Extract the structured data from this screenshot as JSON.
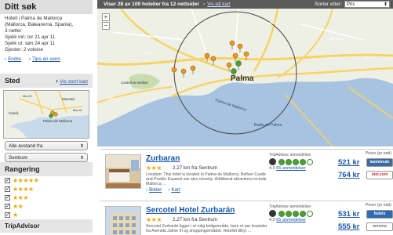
{
  "sidebar": {
    "search": {
      "title": "Ditt søk",
      "lines": [
        "Hotell i Palma de Mallorca",
        "(Mallorca, Balearerna, Spania),",
        "3 netter",
        "Sjekk inn: tor 21 apr 11",
        "Sjekk ut: søn 24 apr 11",
        "Gjester: 2 voksne"
      ],
      "edit_label": "Endre",
      "tips_label": "Tips en venn"
    },
    "place": {
      "title": "Sted",
      "big_map_label": "Vis stort kart",
      "mini_map_labels": [
        "Palma de Mallorca",
        "Marratxí",
        "Ma-13",
        "Ma-19",
        "Calvià"
      ],
      "distance_select": "Alle avstand fra",
      "center_select": "Sentrum"
    },
    "rating": {
      "title": "Rangering",
      "rows": [
        {
          "stars": "★★★★★",
          "checked": "✓"
        },
        {
          "stars": "★★★★",
          "checked": "✓"
        },
        {
          "stars": "★★★",
          "checked": "✓"
        },
        {
          "stars": "★★",
          "checked": "✓"
        },
        {
          "stars": "★",
          "checked": "✓"
        }
      ]
    },
    "tripadvisor": {
      "title": "TripAdvisor"
    }
  },
  "topbar": {
    "count_text": "Viser 28 av 109 hoteller fra 12 nettsider",
    "map_link": "Vis på kart",
    "sort_label": "Sorter etter:",
    "sort_value": "Pris"
  },
  "map": {
    "labels": [
      "Palma",
      "Palma de Mallorca",
      "Ma-20",
      "Ma-19",
      "Ma-13",
      "Ma-1",
      "Castell de Bellver",
      "Ma-1044",
      "Badia de Palma"
    ],
    "colors": {
      "water": "#a8c3e0",
      "land": "#eef0e6",
      "road": "#f6d364",
      "marker": "#f39a1e",
      "selected": "#3fa532"
    }
  },
  "results": [
    {
      "name": "Zurbaran",
      "stars": "★★★",
      "distance": "2,27 km fra Sentrum",
      "description": "Location: This hotel is located in Palma de Mallorca, Bellver Castle and Pueblo Espanol are also closeby. Additional attractions include Mallorca ...",
      "photo_link": "Bilder",
      "map_link": "Kart",
      "ta_label": "TripAdvisor anmeldelser",
      "ta_score": "4.0",
      "ta_reviews": "65 anmeldelser",
      "prices_label": "Priser (pr natt)",
      "prices": [
        {
          "price": "521 kr",
          "site": "lastminute",
          "color": "#3b6aa0"
        },
        {
          "price": "764 kr",
          "site": "otel.com",
          "color": "#c9302c"
        }
      ]
    },
    {
      "name": "Sercotel Hotel Zurbarán",
      "stars": "★★★",
      "distance": "2,27 km fra Sentrum",
      "description": "Sercotel Zurbarán ligger i et rolig boligområde, bare et par kvartaler fra Avenida Jaime III og shoppingområdet. Hotellet tilbyr ...",
      "photo_link": "Bilder",
      "map_link": "Kart",
      "ta_label": "TripAdvisor anmeldelser",
      "ta_score": "4.0",
      "ta_reviews": "65 anmeldelser",
      "prices_label": "Priser (pr natt)",
      "prices": [
        {
          "price": "531 kr",
          "site": "hotels",
          "color": "#2d6cb3"
        },
        {
          "price": "555 kr",
          "site": "amoma",
          "color": "#777777"
        }
      ]
    }
  ]
}
